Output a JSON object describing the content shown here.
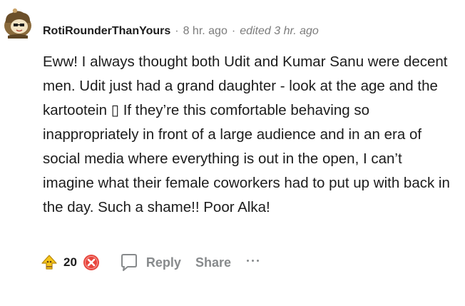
{
  "comment": {
    "username": "RotiRounderThanYours",
    "timestamp": "8 hr. ago",
    "edited": "edited 3 hr. ago",
    "separator": "·",
    "body": "Eww! I always thought both Udit and Kumar Sanu were decent men. Udit just had a grand daughter - look at the age and the kartootein ▯ If they’re this comfortable behaving so inappropriately in front of a large audience and in an era of social media where everything is out in the open, I can’t imagine what their female coworkers had to put up with back in the day. Such a shame!! Poor Alka!",
    "avatar_icon": "reddit-snoo-avatar-icon"
  },
  "actions": {
    "upvote_icon": "upvote-award-icon",
    "score": "20",
    "downvote_icon": "downvote-x-icon",
    "reply_icon": "speech-bubble-icon",
    "reply_label": "Reply",
    "share_label": "Share",
    "more_icon": "more-dots-icon"
  },
  "colors": {
    "text": "#1c1c1c",
    "muted": "#7c7c7c",
    "action_gray": "#878a8c",
    "upvote_yellow": "#f5c518",
    "downvote_red": "#e8453c"
  }
}
